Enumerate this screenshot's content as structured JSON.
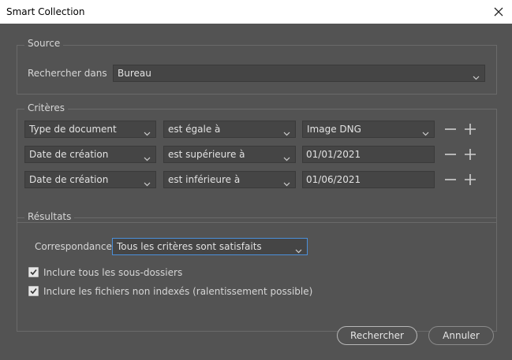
{
  "window": {
    "title": "Smart Collection"
  },
  "source": {
    "legend": "Source",
    "label": "Rechercher dans",
    "value": "Bureau"
  },
  "criteria": {
    "legend": "Critères",
    "rows": [
      {
        "field": "Type de document",
        "operator": "est égale à",
        "value": "Image DNG",
        "value_is_select": true
      },
      {
        "field": "Date de création",
        "operator": "est supérieure à",
        "value": "01/01/2021",
        "value_is_select": false
      },
      {
        "field": "Date de création",
        "operator": "est inférieure à",
        "value": "01/06/2021",
        "value_is_select": false
      }
    ]
  },
  "results": {
    "legend": "Résultats",
    "match_label": "Correspondance",
    "match_value": "Tous les critères sont satisfaits",
    "checkboxes": [
      {
        "label": "Inclure tous les sous-dossiers",
        "checked": true
      },
      {
        "label": "Inclure les fichiers non indexés (ralentissement possible)",
        "checked": true
      }
    ]
  },
  "buttons": {
    "search": "Rechercher",
    "cancel": "Annuler"
  },
  "icons": {
    "close": "close-icon",
    "dropdown": "chevron-down-icon",
    "remove": "minus-icon",
    "add": "plus-icon",
    "check": "checkmark-icon"
  },
  "colors": {
    "panel_bg": "#535353",
    "field_bg": "#454545",
    "focus_border": "#4b8fd9",
    "text": "#d6d6d6"
  }
}
